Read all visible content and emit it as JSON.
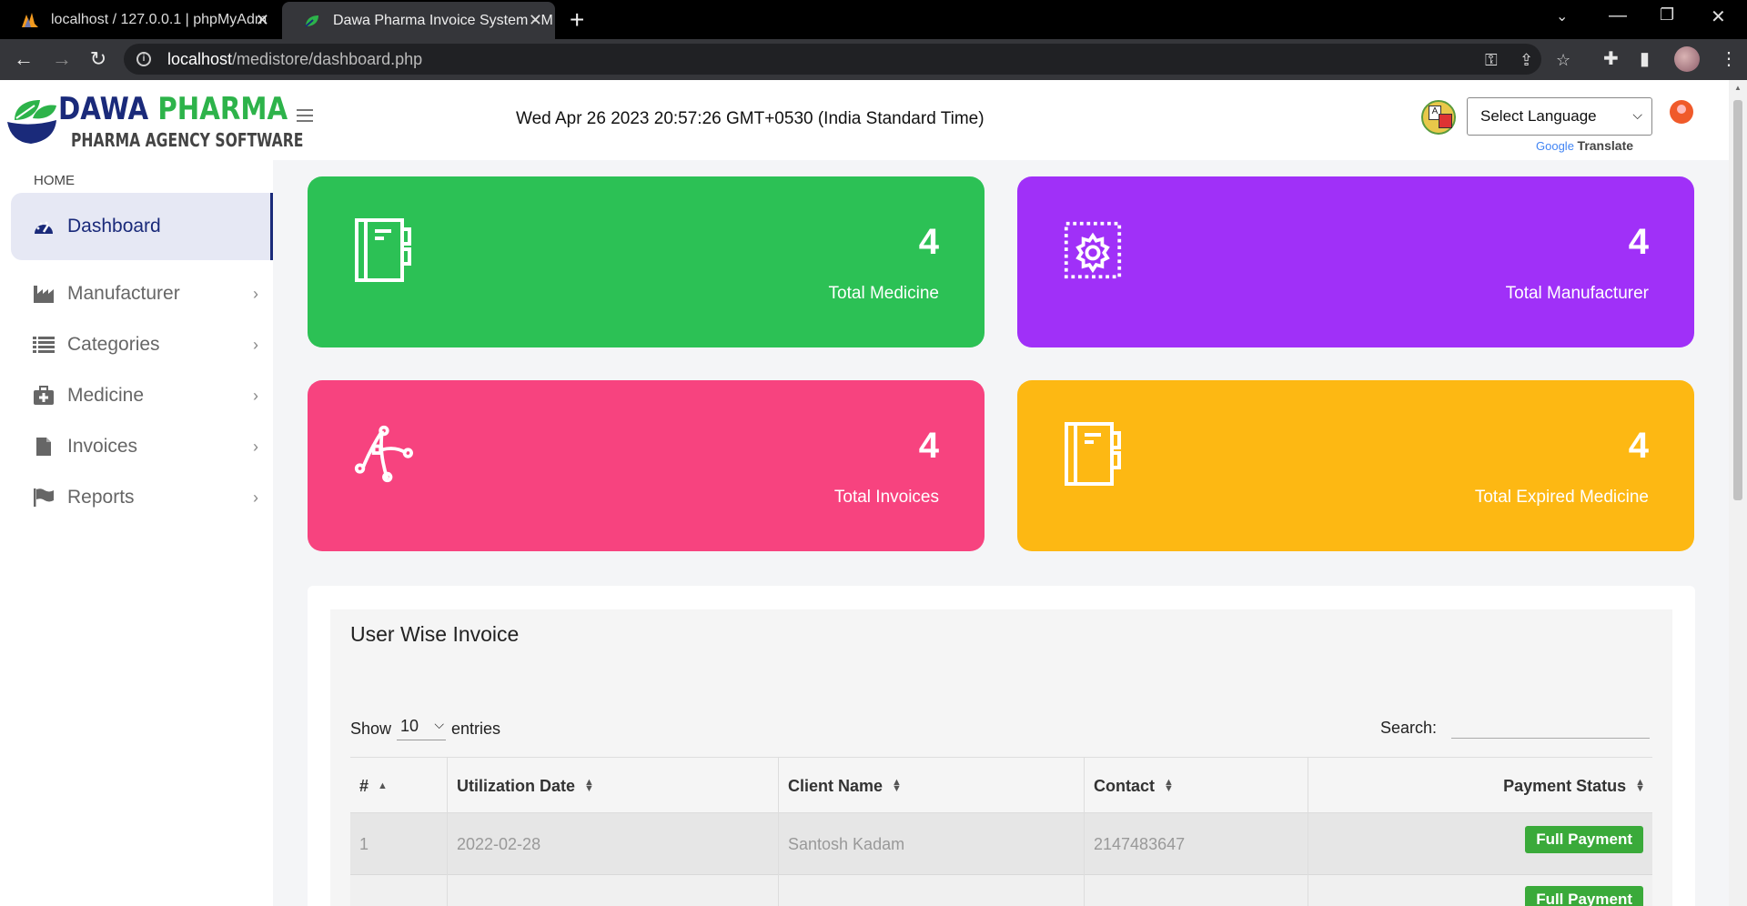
{
  "browser": {
    "tabs": [
      {
        "title": "localhost / 127.0.0.1 | phpMyAdm",
        "active": false
      },
      {
        "title": "Dawa Pharma Invoice System - M",
        "active": true
      }
    ],
    "url_host": "localhost",
    "url_path": "/medistore/dashboard.php"
  },
  "header": {
    "brand_primary_a": "DAWA ",
    "brand_primary_b": "PHARMA",
    "brand_secondary": "PHARMA AGENCY SOFTWARE",
    "datetime": "Wed Apr 26 2023 20:57:26 GMT+0530 (India Standard Time)",
    "language_select": "Select Language",
    "translate_google": "Google",
    "translate_word": "Translate"
  },
  "sidebar": {
    "section": "HOME",
    "items": [
      {
        "label": "Dashboard",
        "icon": "dashboard-gauge-icon"
      },
      {
        "label": "Manufacturer",
        "icon": "industry-icon"
      },
      {
        "label": "Categories",
        "icon": "list-icon"
      },
      {
        "label": "Medicine",
        "icon": "medkit-icon"
      },
      {
        "label": "Invoices",
        "icon": "file-icon"
      },
      {
        "label": "Reports",
        "icon": "flag-icon"
      }
    ]
  },
  "cards": [
    {
      "value": "4",
      "label": "Total Medicine",
      "color": "#2cc155",
      "icon": "notebook-icon"
    },
    {
      "value": "4",
      "label": "Total Manufacturer",
      "color": "#a030f8",
      "icon": "gear-frame-icon"
    },
    {
      "value": "4",
      "label": "Total Invoices",
      "color": "#f7437f",
      "icon": "vector-path-icon"
    },
    {
      "value": "4",
      "label": "Total Expired Medicine",
      "color": "#fdb813",
      "icon": "notebook-icon"
    }
  ],
  "table": {
    "title": "User Wise Invoice",
    "show_prefix": "Show",
    "show_value": "10",
    "show_suffix": "entries",
    "search_label": "Search:",
    "columns": [
      "#",
      "Utilization Date",
      "Client Name",
      "Contact",
      "Payment Status"
    ],
    "rows": [
      {
        "id": "1",
        "date": "2022-02-28",
        "client": "Santosh Kadam",
        "contact": "2147483647",
        "status": "Full Payment"
      },
      {
        "id": "",
        "date": "",
        "client": "",
        "contact": "",
        "status": "Full Payment"
      }
    ]
  }
}
